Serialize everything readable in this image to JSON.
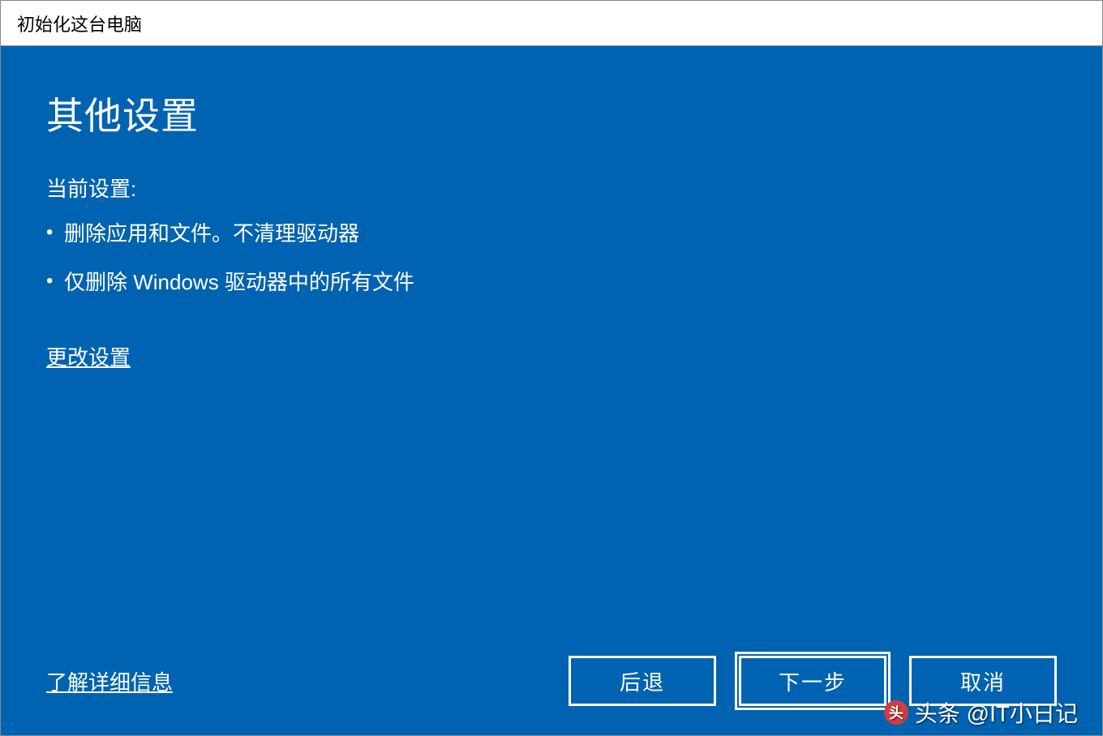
{
  "window": {
    "title": "初始化这台电脑"
  },
  "main": {
    "heading": "其他设置",
    "subheading": "当前设置:",
    "bullets": [
      "删除应用和文件。不清理驱动器",
      "仅删除 Windows 驱动器中的所有文件"
    ],
    "change_link": "更改设置"
  },
  "footer": {
    "learn_more": "了解详细信息",
    "back": "后退",
    "next": "下一步",
    "cancel": "取消"
  },
  "watermark": {
    "text": "头条 @IT小日记"
  }
}
